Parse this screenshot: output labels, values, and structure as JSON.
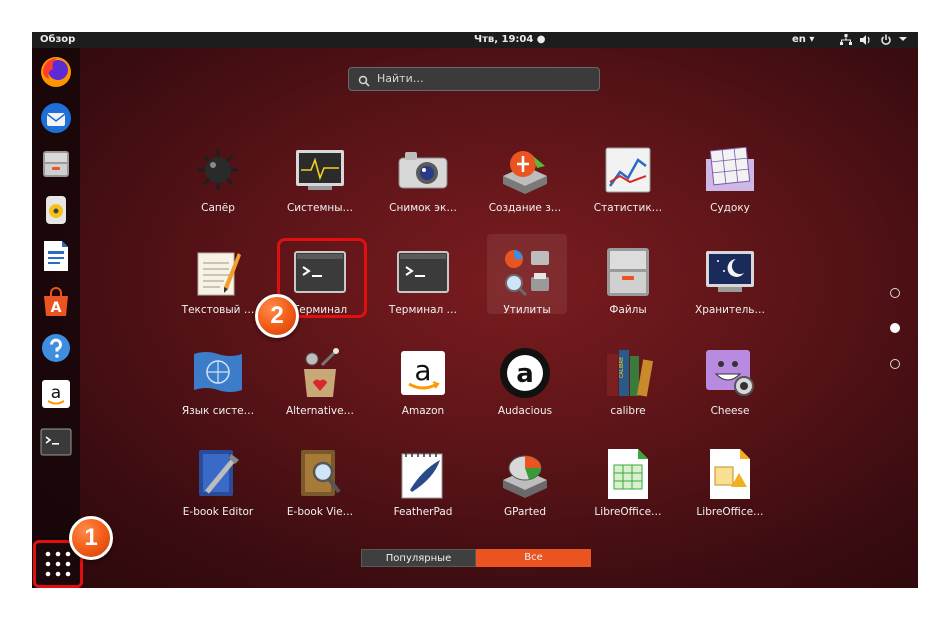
{
  "topbar": {
    "activities": "Обзор",
    "clock": "Чтв, 19:04 ●",
    "language": "en ▾"
  },
  "search": {
    "placeholder": "Найти…"
  },
  "apps": [
    {
      "label": "Сапёр",
      "icon": "mines-icon"
    },
    {
      "label": "Системны…",
      "icon": "system-monitor-icon"
    },
    {
      "label": "Снимок эк…",
      "icon": "camera-icon"
    },
    {
      "label": "Создание з…",
      "icon": "startup-disk-icon"
    },
    {
      "label": "Статистик…",
      "icon": "statistics-icon"
    },
    {
      "label": "Судоку",
      "icon": "sudoku-icon"
    },
    {
      "label": "Текстовый …",
      "icon": "text-editor-icon"
    },
    {
      "label": "Терминал",
      "icon": "terminal-icon"
    },
    {
      "label": "Терминал …",
      "icon": "terminal-icon"
    },
    {
      "label": "Утилиты",
      "icon": "utilities-folder-icon"
    },
    {
      "label": "Файлы",
      "icon": "files-icon"
    },
    {
      "label": "Хранитель…",
      "icon": "screensaver-icon"
    },
    {
      "label": "Язык систе…",
      "icon": "language-icon"
    },
    {
      "label": "Alternative…",
      "icon": "alternatives-icon"
    },
    {
      "label": "Amazon",
      "icon": "amazon-icon"
    },
    {
      "label": "Audacious",
      "icon": "audacious-icon"
    },
    {
      "label": "calibre",
      "icon": "calibre-icon"
    },
    {
      "label": "Cheese",
      "icon": "cheese-icon"
    },
    {
      "label": "E-book Editor",
      "icon": "ebook-editor-icon"
    },
    {
      "label": "E-book Vie…",
      "icon": "ebook-viewer-icon"
    },
    {
      "label": "FeatherPad",
      "icon": "featherpad-icon"
    },
    {
      "label": "GParted",
      "icon": "gparted-icon"
    },
    {
      "label": "LibreOffice…",
      "icon": "libreoffice-calc-icon"
    },
    {
      "label": "LibreOffice…",
      "icon": "libreoffice-draw-icon"
    }
  ],
  "dock": [
    {
      "icon": "firefox-icon"
    },
    {
      "icon": "thunderbird-icon"
    },
    {
      "icon": "files-icon"
    },
    {
      "icon": "rhythmbox-icon"
    },
    {
      "icon": "libreoffice-writer-icon"
    },
    {
      "icon": "software-center-icon"
    },
    {
      "icon": "help-icon"
    },
    {
      "icon": "amazon-icon"
    },
    {
      "icon": "terminal-icon"
    },
    {
      "icon": "show-applications-icon"
    }
  ],
  "amazon_glyph": "a",
  "calibre_text": "CALIBRE",
  "tabs": [
    {
      "label": "Популярные",
      "active": false
    },
    {
      "label": "Все",
      "active": true
    }
  ],
  "pages": {
    "count": 3,
    "current": 2
  },
  "annotations": [
    {
      "number": "1"
    },
    {
      "number": "2"
    }
  ],
  "colors": {
    "accent": "#e95420",
    "highlight": "#e01010",
    "wallpaper": "#5b1418"
  }
}
